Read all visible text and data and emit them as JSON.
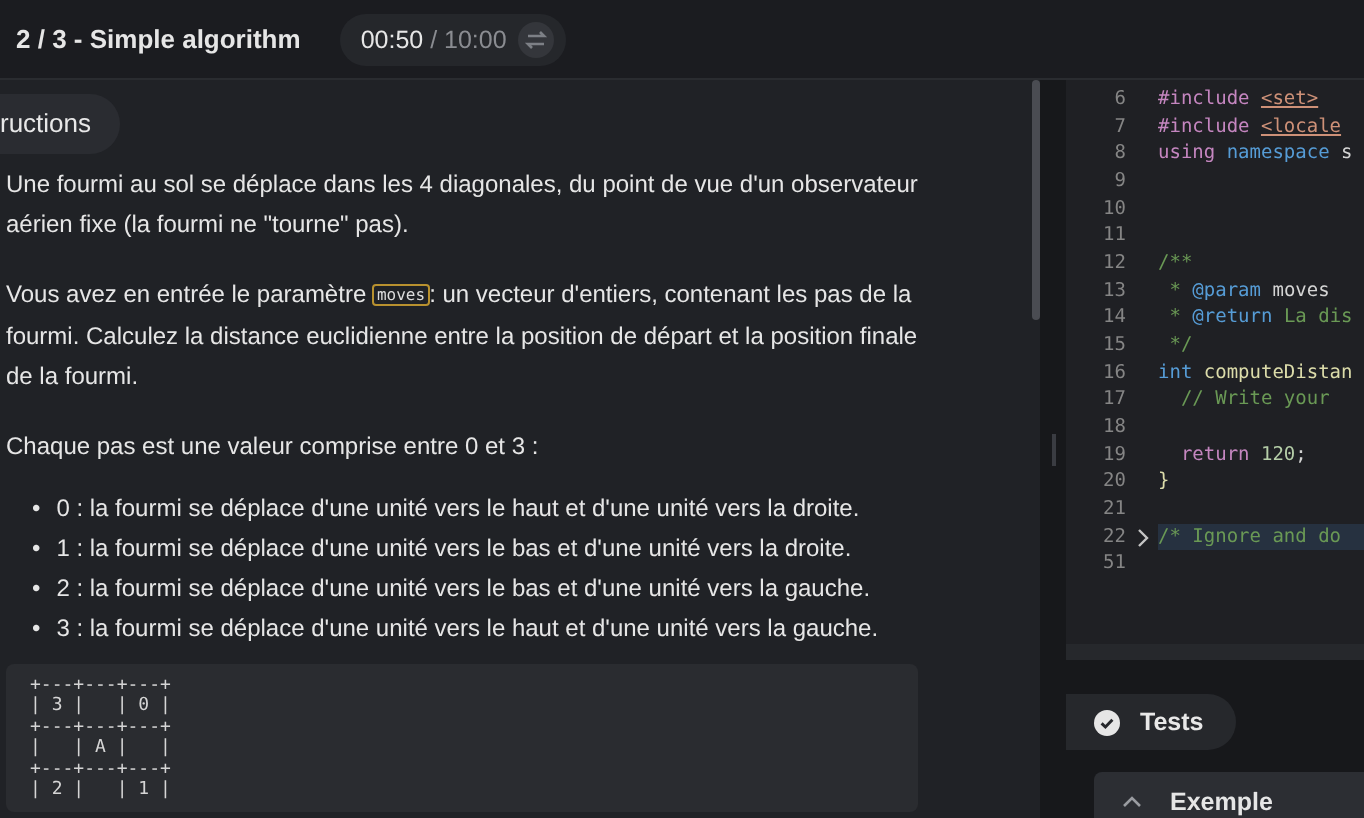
{
  "header": {
    "title": "2 / 3 - Simple algorithm",
    "timer": {
      "elapsed": "00:50",
      "separator": " / ",
      "total": "10:00"
    }
  },
  "instructions": {
    "tab": {
      "label": "ructions",
      "selected": true
    },
    "paragraphs": [
      {
        "text": "Une fourmi au sol se déplace dans les 4 diagonales, du point de vue d'un observateur aérien fixe (la fourmi ne \"tourne\" pas)."
      },
      {
        "text": "Vous avez en entrée le paramètre",
        "code": "moves",
        "after": ": un vecteur d'entiers, contenant les pas de la fourmi. Calculez la distance euclidienne entre la position de départ et la position finale de la fourmi."
      },
      {
        "text": "Chaque pas est une valeur comprise entre 0 et 3 :"
      }
    ],
    "list": [
      {
        "marker": "•",
        "text": "0 : la fourmi se déplace d'une unité vers le haut et d'une unité vers la droite."
      },
      {
        "marker": "•",
        "text": "1 : la fourmi se déplace d'une unité vers le bas et d'une unité vers la droite."
      },
      {
        "marker": "•",
        "text": "2 : la fourmi se déplace d'une unité vers le bas et d'une unité vers la gauche."
      },
      {
        "marker": "•",
        "text": "3 : la fourmi se déplace d'une unité vers le haut et d'une unité vers la gauche."
      }
    ],
    "diagram": "+---+---+---+\n| 3 |   | 0 |\n+---+---+---+\n|   | A |   |\n+---+---+---+\n| 2 |   | 1 |"
  },
  "editor": {
    "lines": [
      {
        "number": "6",
        "tokens": [
          {
            "kind": "keyword",
            "text": "#include "
          },
          {
            "kind": "include",
            "text": "<set>"
          }
        ]
      },
      {
        "number": "7",
        "tokens": [
          {
            "kind": "keyword",
            "text": "#include "
          },
          {
            "kind": "include",
            "text": "<locale"
          }
        ]
      },
      {
        "number": "8",
        "tokens": [
          {
            "kind": "keyword",
            "text": "using "
          },
          {
            "kind": "type",
            "text": "namespace "
          },
          {
            "kind": "plain",
            "text": "s"
          }
        ]
      },
      {
        "number": "9"
      },
      {
        "number": "10"
      },
      {
        "number": "11"
      },
      {
        "number": "12",
        "tokens": [
          {
            "kind": "comment",
            "text": "/**"
          }
        ]
      },
      {
        "number": "13",
        "tokens": [
          {
            "kind": "comment",
            "text": " * "
          },
          {
            "kind": "tag",
            "text": "@param "
          },
          {
            "kind": "plain",
            "text": "moves"
          }
        ]
      },
      {
        "number": "14",
        "tokens": [
          {
            "kind": "comment",
            "text": " * "
          },
          {
            "kind": "tag",
            "text": "@return "
          },
          {
            "kind": "comment",
            "text": "La dis"
          }
        ]
      },
      {
        "number": "15",
        "tokens": [
          {
            "kind": "comment",
            "text": " */"
          }
        ]
      },
      {
        "number": "16",
        "tokens": [
          {
            "kind": "type",
            "text": "int "
          },
          {
            "kind": "function",
            "text": "computeDistan"
          }
        ]
      },
      {
        "number": "17",
        "tokens": [
          {
            "kind": "comment",
            "text": "  // Write your"
          }
        ]
      },
      {
        "number": "18"
      },
      {
        "number": "19",
        "tokens": [
          {
            "kind": "keyword",
            "text": "  return "
          },
          {
            "kind": "number",
            "text": "120"
          },
          {
            "kind": "plain",
            "text": ";"
          }
        ]
      },
      {
        "number": "20",
        "tokens": [
          {
            "kind": "function",
            "text": "}"
          }
        ]
      },
      {
        "number": "21"
      },
      {
        "number": "22",
        "folded": true,
        "tokens": [
          {
            "kind": "comment",
            "text": "/* Ignore and do"
          }
        ]
      },
      {
        "number": "51"
      }
    ]
  },
  "tests": {
    "tab": {
      "label": "Tests",
      "selected": true
    },
    "section": {
      "label": "Exemple",
      "expanded": true
    }
  }
}
